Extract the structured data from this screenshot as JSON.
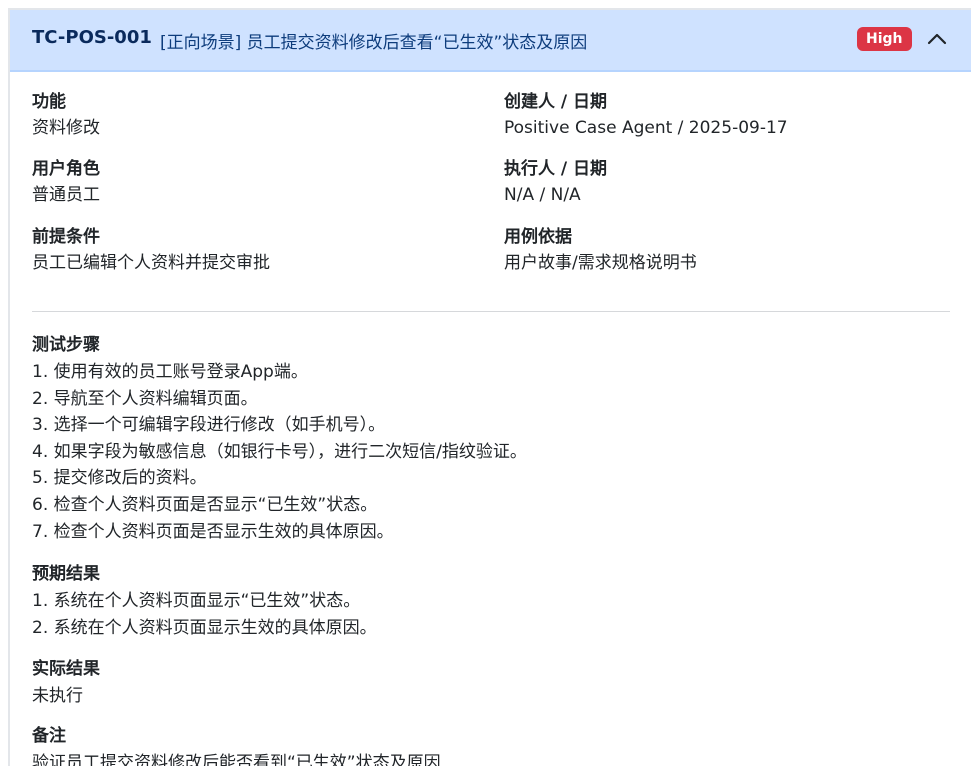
{
  "header": {
    "case_id": "TC-POS-001",
    "title": "[正向场景] 员工提交资料修改后查看“已生效”状态及原因",
    "priority": "High",
    "toggle_icon": "chevron-up-icon",
    "header_bg": "#cfe2ff",
    "badge_color": "#dc3545"
  },
  "fields": {
    "feature": {
      "label": "功能",
      "value": "资料修改"
    },
    "creator": {
      "label": "创建人 / 日期",
      "value": "Positive Case Agent / 2025-09-17"
    },
    "role": {
      "label": "用户角色",
      "value": "普通员工"
    },
    "executor": {
      "label": "执行人 / 日期",
      "value": "N/A / N/A"
    },
    "precondition": {
      "label": "前提条件",
      "value": "员工已编辑个人资料并提交审批"
    },
    "basis": {
      "label": "用例依据",
      "value": "用户故事/需求规格说明书"
    }
  },
  "steps": {
    "title": "测试步骤",
    "items": [
      "1. 使用有效的员工账号登录App端。",
      "2. 导航至个人资料编辑页面。",
      "3. 选择一个可编辑字段进行修改（如手机号）。",
      "4. 如果字段为敏感信息（如银行卡号），进行二次短信/指纹验证。",
      "5. 提交修改后的资料。",
      "6. 检查个人资料页面是否显示“已生效”状态。",
      "7. 检查个人资料页面是否显示生效的具体原因。"
    ]
  },
  "expected": {
    "title": "预期结果",
    "items": [
      "1. 系统在个人资料页面显示“已生效”状态。",
      "2. 系统在个人资料页面显示生效的具体原因。"
    ]
  },
  "actual": {
    "title": "实际结果",
    "value": "未执行"
  },
  "notes": {
    "title": "备注",
    "value": "验证员工提交资料修改后能否看到“已生效”状态及原因"
  }
}
